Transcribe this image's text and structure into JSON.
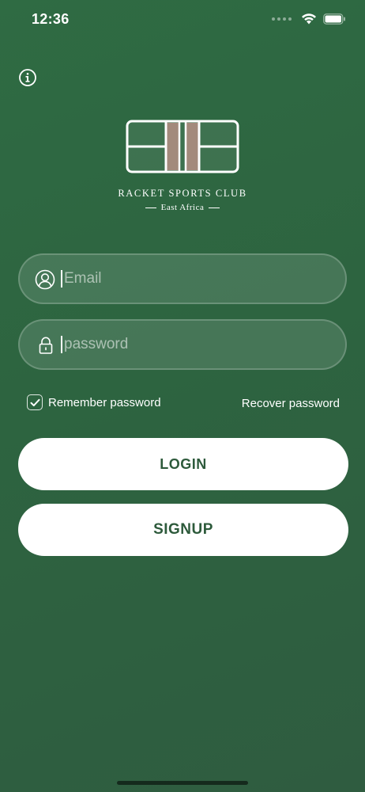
{
  "status_bar": {
    "time": "12:36"
  },
  "icons": {
    "info": "info-icon",
    "wifi": "wifi-icon",
    "battery": "battery-icon",
    "user": "user-icon",
    "lock": "lock-icon",
    "check": "check-icon"
  },
  "logo": {
    "title": "RACKET SPORTS CLUB",
    "subtitle": "East Africa"
  },
  "login_form": {
    "email_placeholder": "Email",
    "email_value": "",
    "password_placeholder": "password",
    "password_value": "",
    "remember_label": "Remember password",
    "remember_checked": true,
    "recover_label": "Recover password",
    "login_label": "LOGIN",
    "signup_label": "SIGNUP"
  },
  "colors": {
    "background": "#2f6b43",
    "button_background": "#ffffff",
    "button_text": "#2d5a3b",
    "court_lane": "#a38a7c"
  }
}
